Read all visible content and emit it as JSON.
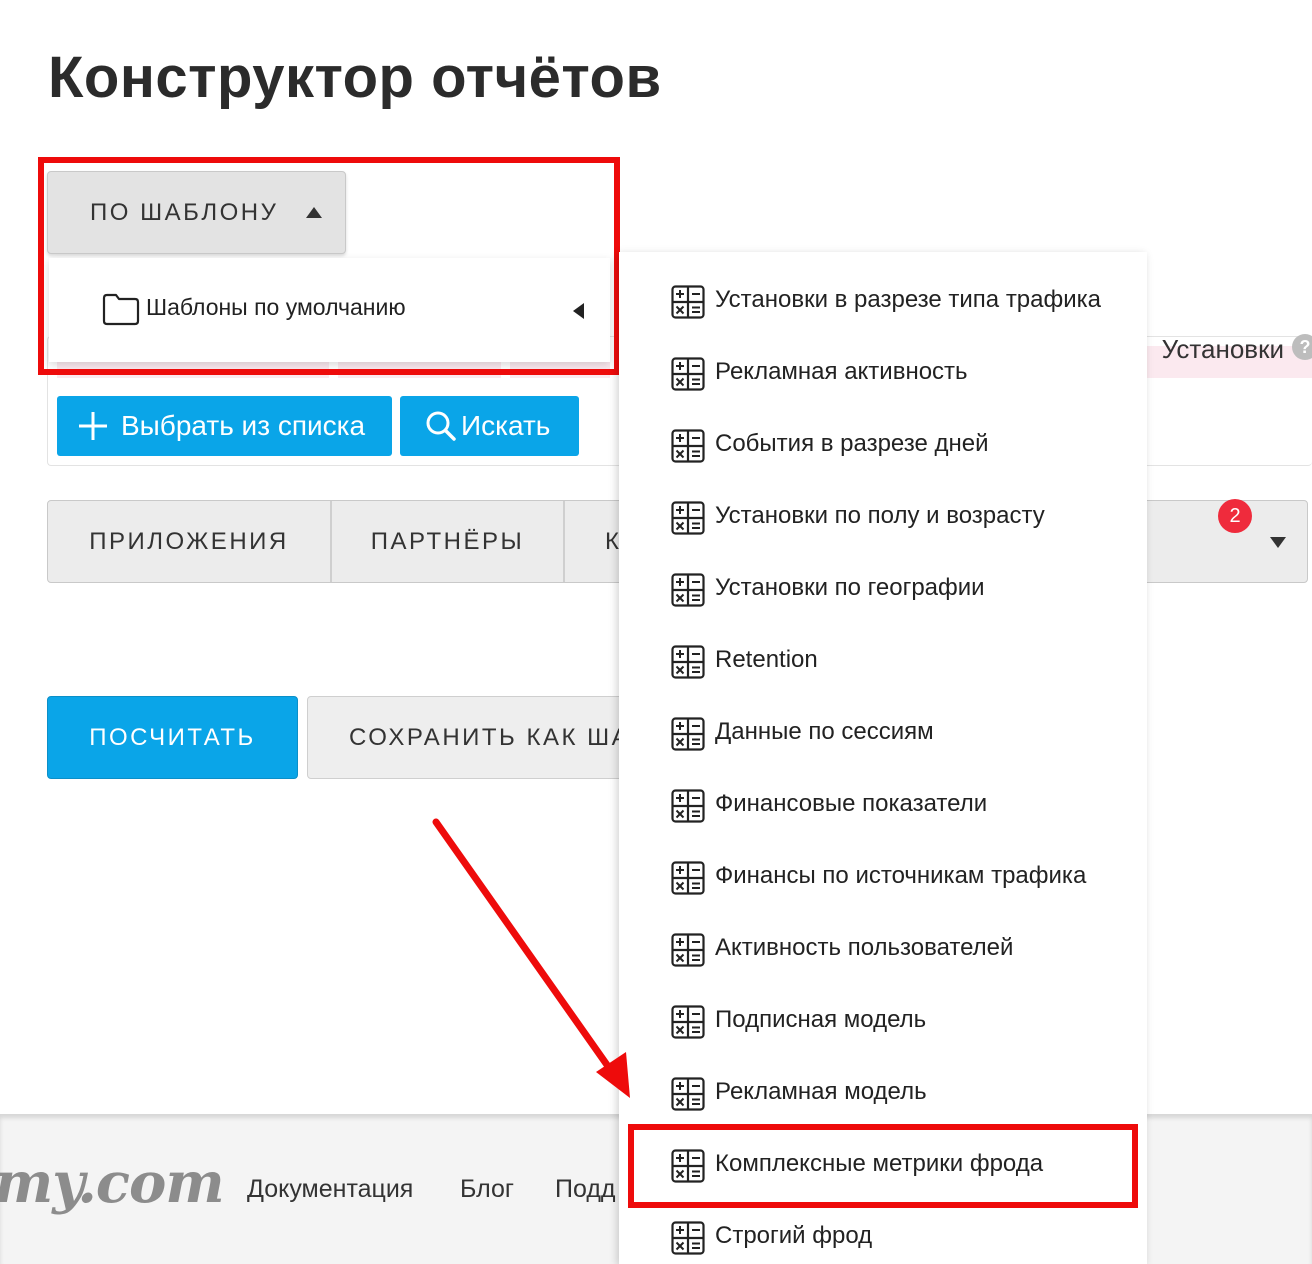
{
  "page": {
    "title": "Конструктор отчётов"
  },
  "template_button": {
    "label": "ПО ШАБЛОНУ"
  },
  "submenu": {
    "label": "Шаблоны по умолчанию"
  },
  "filters": {
    "chip_label": "Установки",
    "help": "?",
    "choose_label": "Выбрать из списка",
    "search_label": "Искать"
  },
  "tabs": {
    "items": [
      {
        "label": "ПРИЛОЖЕНИЯ"
      },
      {
        "label": "ПАРТНЁРЫ"
      },
      {
        "label": "К"
      }
    ],
    "badge": "2"
  },
  "actions": {
    "calculate_label": "ПОСЧИТАТЬ",
    "save_label": "СОХРАНИТЬ КАК ША"
  },
  "footer": {
    "logo": "my.com",
    "links": [
      "Документация",
      "Блог",
      "Подд"
    ]
  },
  "templates_menu": {
    "items": [
      "Установки в разрезе типа трафика",
      "Рекламная активность",
      "События в разрезе дней",
      "Установки по полу и возрасту",
      "Установки по географии",
      "Retention",
      "Данные по сессиям",
      "Финансовые показатели",
      "Финансы по источникам трафика",
      "Активность пользователей",
      "Подписная модель",
      "Рекламная модель",
      "Комплексные метрики фрода",
      "Строгий фрод"
    ]
  },
  "colors": {
    "accent": "#0aa5e8",
    "annotation": "#ee0b0b",
    "badge": "#ef2b3c"
  }
}
